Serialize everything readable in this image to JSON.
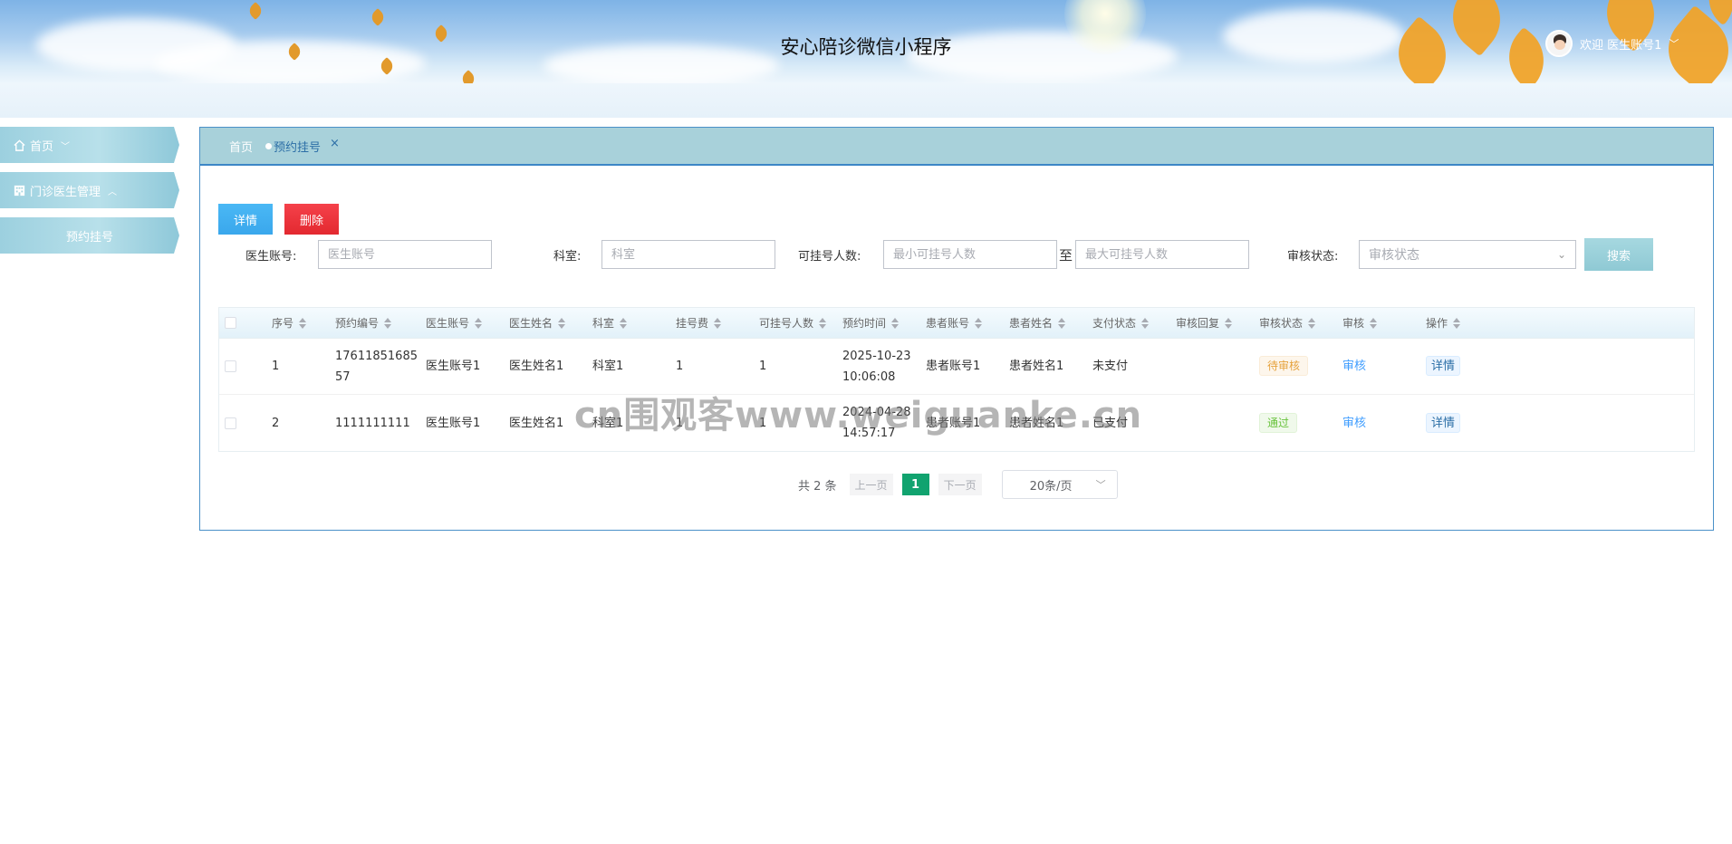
{
  "app": {
    "title": "安心陪诊微信小程序"
  },
  "user": {
    "greeting": "欢迎 医生账号1",
    "chevron": "﹀"
  },
  "sidebar": {
    "items": [
      {
        "label": "首页",
        "chevron": "﹀"
      },
      {
        "label": "门诊医生管理",
        "chevron": "︿"
      },
      {
        "label": "预约挂号"
      }
    ]
  },
  "tabs": {
    "home": "首页",
    "active": "预约挂号",
    "close": "×"
  },
  "toolbar": {
    "detail": "详情",
    "delete": "删除"
  },
  "filters": {
    "doctor_account_label": "医生账号:",
    "doctor_account_placeholder": "医生账号",
    "dept_label": "科室:",
    "dept_placeholder": "科室",
    "count_label": "可挂号人数:",
    "min_placeholder": "最小可挂号人数",
    "to": "至",
    "max_placeholder": "最大可挂号人数",
    "status_label": "审核状态:",
    "status_placeholder": "审核状态",
    "search": "搜索"
  },
  "table": {
    "headers": [
      "序号",
      "预约编号",
      "医生账号",
      "医生姓名",
      "科室",
      "挂号费",
      "可挂号人数",
      "预约时间",
      "患者账号",
      "患者姓名",
      "支付状态",
      "审核回复",
      "审核状态",
      "审核",
      "操作"
    ],
    "rows": [
      {
        "index": "1",
        "code": "1761185168557",
        "doctor_account": "医生账号1",
        "doctor_name": "医生姓名1",
        "dept": "科室1",
        "fee": "1",
        "count": "1",
        "time": "2025-10-23 10:06:08",
        "patient_account": "患者账号1",
        "patient_name": "患者姓名1",
        "pay": "未支付",
        "reply": "",
        "status": "待审核",
        "audit": "审核",
        "op": "详情"
      },
      {
        "index": "2",
        "code": "1111111111",
        "doctor_account": "医生账号1",
        "doctor_name": "医生姓名1",
        "dept": "科室1",
        "fee": "1",
        "count": "1",
        "time": "2024-04-28 14:57:17",
        "patient_account": "患者账号1",
        "patient_name": "患者姓名1",
        "pay": "已支付",
        "reply": "",
        "status": "通过",
        "audit": "审核",
        "op": "详情"
      }
    ]
  },
  "pager": {
    "total": "共 2 条",
    "prev": "上一页",
    "page": "1",
    "next": "下一页",
    "size": "20条/页",
    "size_chevron": "﹀"
  },
  "watermark": "cn围观客www.weiguanke.cn",
  "colors": {
    "accent": "#11a36f",
    "tab_bg": "#a8d1da",
    "panel_border": "#4a91c8",
    "delete": "#e32930",
    "detail": "#3aa7ec"
  }
}
